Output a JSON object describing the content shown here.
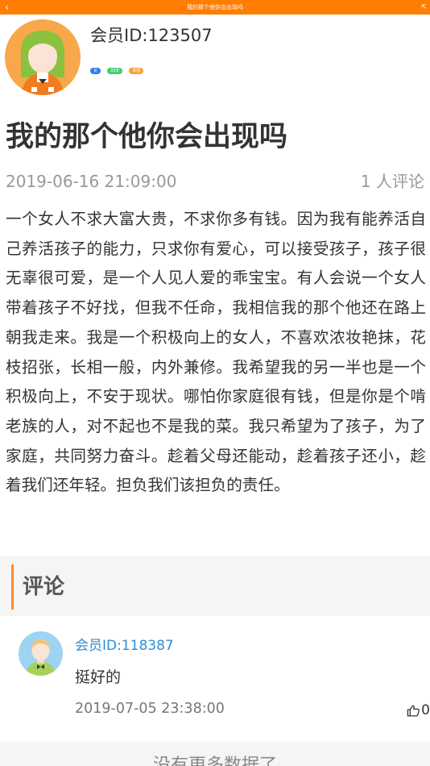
{
  "topbar": {
    "title": "我的那个他你会出现吗",
    "back_glyph": "‹",
    "share_glyph": "⇱"
  },
  "author": {
    "name": "会员ID:123507",
    "badges": [
      "女",
      "33岁",
      "未婚"
    ],
    "avatar_icon": "female-avatar-icon"
  },
  "post": {
    "title": "我的那个他你会出现吗",
    "date": "2019-06-16 21:09:00",
    "comment_count": "1 人评论",
    "body": "一个女人不求大富大贵，不求你多有钱。因为我有能养活自己养活孩子的能力，只求你有爱心，可以接受孩子，孩子很无辜很可爱，是一个人见人爱的乖宝宝。有人会说一个女人带着孩子不好找，但我不任命，我相信我的那个他还在路上朝我走来。我是一个积极向上的女人，不喜欢浓妆艳抹，花枝招张，长相一般，内外兼修。我希望我的另一半也是一个积极向上，不安于现状。哪怕你家庭很有钱，但是你是个啃老族的人，对不起也不是我的菜。我只希望为了孩子，为了家庭，共同努力奋斗。趁着父母还能动，趁着孩子还小，趁着我们还年轻。担负我们该担负的责任。"
  },
  "comments_section": {
    "title": "评论",
    "items": [
      {
        "user": "会员ID:118387",
        "text": "挺好的",
        "date": "2019-07-05 23:38:00",
        "likes": "0",
        "avatar_icon": "male-avatar-icon"
      }
    ]
  },
  "footer": {
    "text": "没有更多数据了"
  },
  "colors": {
    "accent": "#ff7d00",
    "link": "#2f8fd8"
  }
}
